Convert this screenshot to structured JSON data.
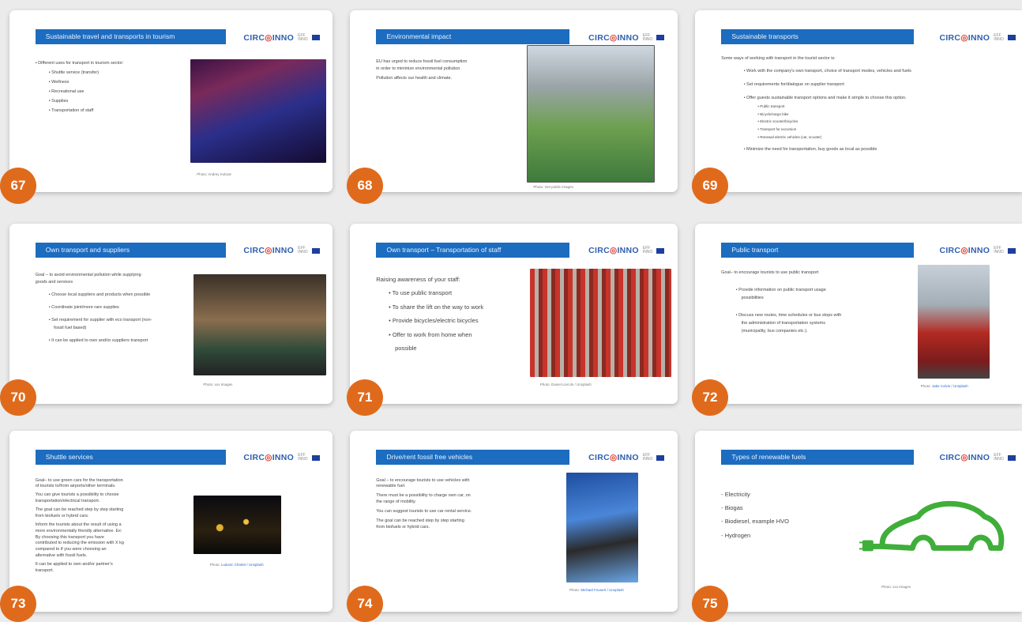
{
  "logo": {
    "text_a": "CIRC",
    "text_b": "INNO",
    "partner_lines": [
      "EFF",
      "INNO"
    ]
  },
  "colors": {
    "title_bar": "#1c6cc0",
    "badge": "#e06a1c",
    "eu_flag": "#1d3e9c"
  },
  "slides": [
    {
      "number": "67",
      "title": "Sustainable travel and transports in tourism",
      "lines": [
        "• Different uses for transport in tourism sector:",
        "• Shuttle service (transfer)",
        "• Wellness",
        "• Recreational use",
        "• Supplies",
        "• Transportation of staff"
      ],
      "image": "night-bus-photo",
      "caption": "Photo: Andrey Kobzar"
    },
    {
      "number": "68",
      "title": "Environmental impact",
      "lines": [
        "EU has urged to reduce fossil fuel consumption",
        "in order to minimize environmental pollution.",
        "Pollution affects our health and climate."
      ],
      "image": "pollution-illustration",
      "caption": "Photo: Get public Images"
    },
    {
      "number": "69",
      "title": "Sustainable transports",
      "lines": [
        "Some ways of working with transport in the tourist sector is:",
        "• Work with the company's own transport, choice of transport modes, vehicles and fuels",
        "• Set requirements for/dialogue on supplier transport",
        "• Offer guests sustainable transport options and make it simple to choose this option.",
        "• Public transport",
        "• Bicycle/cargo bike",
        "• Electric scooter/bicycles",
        "• Transport for excursion",
        "• Renewal electric vehicles (car, scooter)",
        "• Minimize the need for transportation, buy goods as local as possible"
      ],
      "image": "",
      "caption": ""
    },
    {
      "number": "70",
      "title": "Own transport and suppliers",
      "lines": [
        "Goal – to avoid environmental pollution while supplying",
        "goods and services",
        "• Choose local suppliers and products when possible",
        "• Coordinate joint/more rare supplies",
        "• Set requirement for supplier with eco transport (non-",
        "fossil fuel based)",
        "• It can be applied to own and/or suppliers transport"
      ],
      "image": "toy-car-boxes-photo",
      "caption": "Photo: xxx Images"
    },
    {
      "number": "71",
      "title": "Own transport – Transportation of staff",
      "lines": [
        "Raising awareness of your staff:",
        "• To use public transport",
        "• To share the lift on the way to work",
        "• Provide bicycles/electric bicycles",
        "• Offer to work from home when",
        "possible"
      ],
      "image": "bike-share-photo",
      "caption": "Photo: Daniel Lincoln / Unsplash"
    },
    {
      "number": "72",
      "title": "Public transport",
      "lines": [
        "Goal– to encourage tourists to use public transport",
        "• Provide information on public transport usage",
        "possibilities",
        "• Discuss new routes, time schedules or bus stops with",
        "the administration of transportation systems",
        "(municipality, bus companies etc.)."
      ],
      "image": "red-bus-photo",
      "caption_prefix": "Photo:",
      "caption_link": "Jake Colvin / Unsplash"
    },
    {
      "number": "73",
      "title": "Shuttle services",
      "lines": [
        "Goal– to use green cars for the transportation",
        "of tourists to/from airports/other terminals.",
        "You can give tourists a possibility to choose",
        "transportation/electrical transport.",
        "The goal can be reached step by step starting",
        "from biofuels or hybrid cars.",
        "Inform the tourists about the result of using a",
        "more environmentally friendly alternative. Ex:",
        "By choosing this transport you have",
        "contributed to reducing the emission with X kg",
        "compared to if you were choosing an",
        "alternative with fossil fuels.",
        "It can be applied to own and/or partner's",
        "transport."
      ],
      "image": "night-taxi-photo",
      "caption_prefix": "Photo:",
      "caption_link": "Ludovic Charlet / Unsplash"
    },
    {
      "number": "74",
      "title": "Drive/rent fossil free vehicles",
      "lines": [
        "Goal – to encourage tourists to use vehicles with",
        "renewable fuel.",
        "There must be a possibility to charge own car, on",
        "the range of mobility.",
        "You can suggest tourists to use car rental service.",
        "The goal can be reached step by step starting",
        "from biofuels or hybrid cars."
      ],
      "image": "ev-charger-photo",
      "caption_prefix": "Photo:",
      "caption_link": "Michael Fousert / Unsplash"
    },
    {
      "number": "75",
      "title": "Types of renewable fuels",
      "lines": [
        "- Electricity",
        "- Biogas",
        "- Biodiesel, example HVO",
        "- Hydrogen"
      ],
      "image": "green-plug-car-drawing",
      "caption": "Photo: xxx Images"
    }
  ]
}
